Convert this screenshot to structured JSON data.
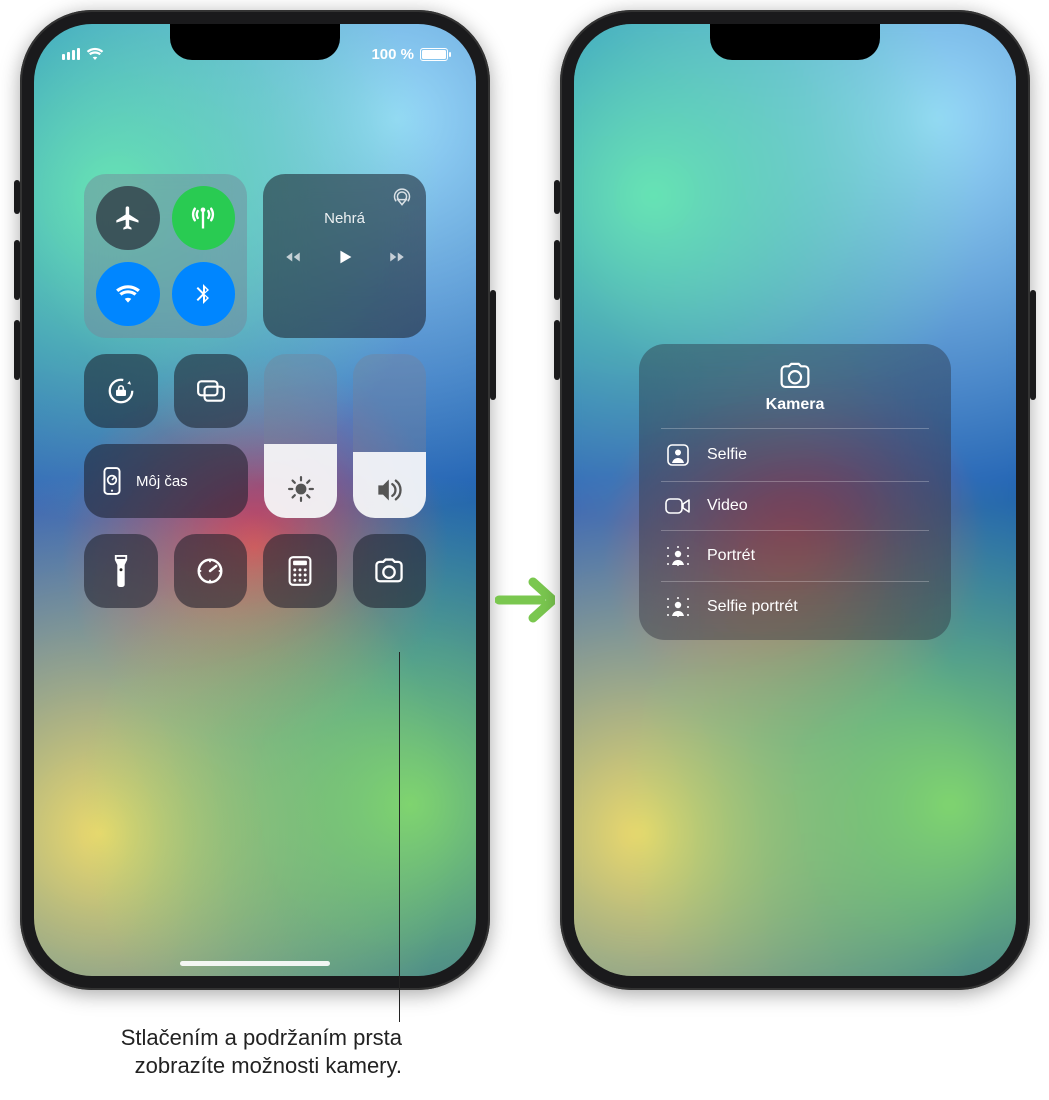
{
  "status": {
    "battery_percent": "100 %"
  },
  "media": {
    "now_playing": "Nehrá"
  },
  "screen_time": {
    "label": "Môj čas"
  },
  "sliders": {
    "brightness_percent": 45,
    "volume_percent": 40
  },
  "camera_menu": {
    "title": "Kamera",
    "items": [
      {
        "icon": "person-square",
        "label": "Selfie"
      },
      {
        "icon": "video",
        "label": "Video"
      },
      {
        "icon": "portrait",
        "label": "Portrét"
      },
      {
        "icon": "portrait-selfie",
        "label": "Selfie portrét"
      }
    ]
  },
  "callout": {
    "line1": "Stlačením a podržaním prsta",
    "line2": "zobrazíte možnosti kamery."
  }
}
